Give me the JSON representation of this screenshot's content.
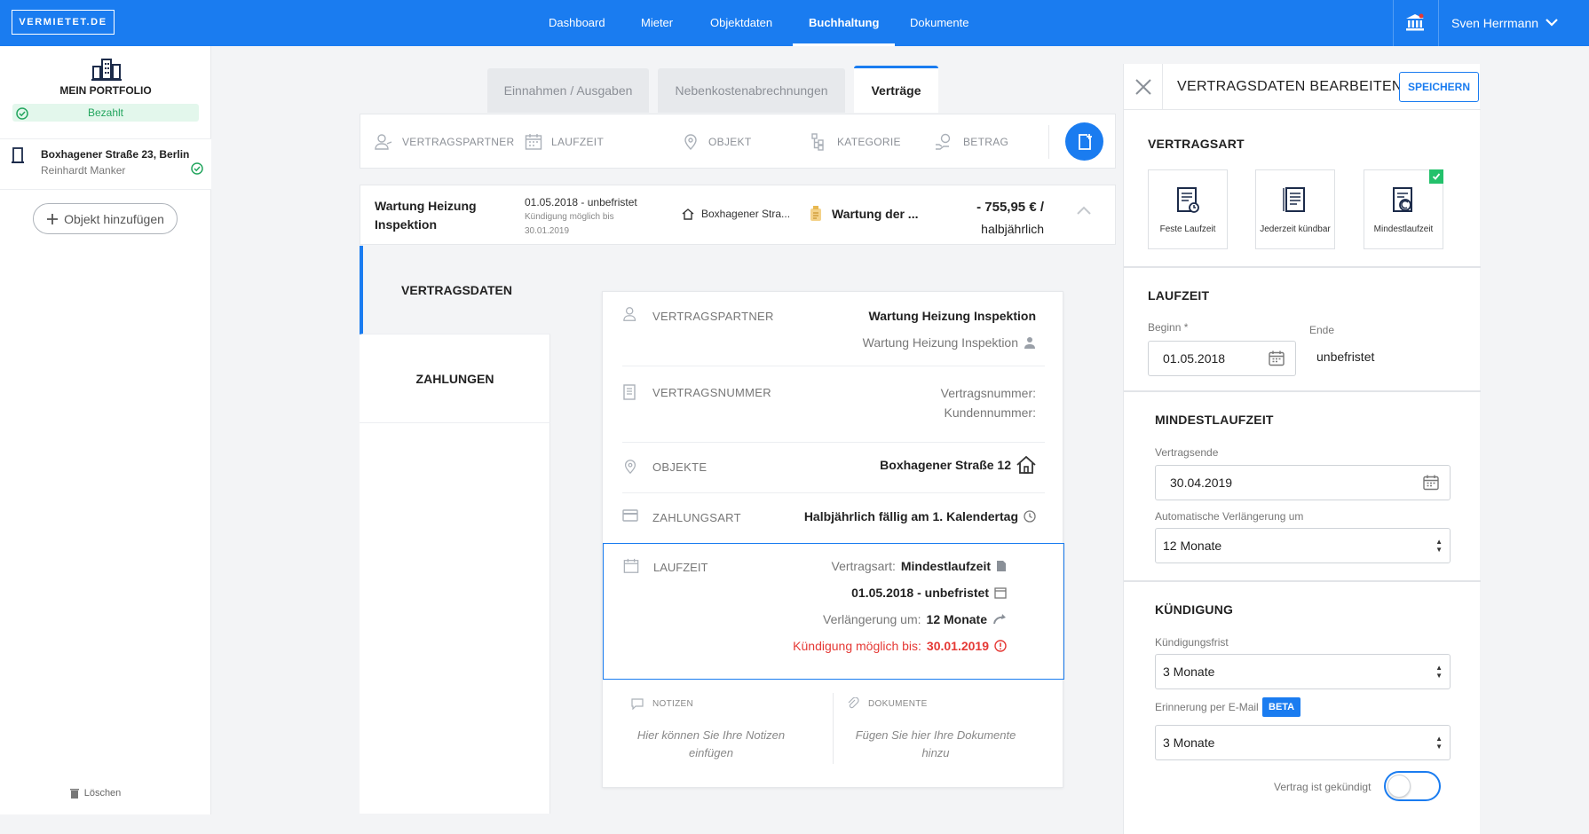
{
  "app": {
    "logo": "VERMIETET.DE",
    "brand_color": "#1a7cf0"
  },
  "nav": {
    "items": [
      "Dashboard",
      "Mieter",
      "Objektdaten",
      "Buchhaltung",
      "Dokumente"
    ],
    "active": "Buchhaltung",
    "user": "Sven Herrmann"
  },
  "sidebar": {
    "title": "MEIN PORTFOLIO",
    "status": "Bezahlt",
    "object": {
      "name": "Boxhagener Straße 23, Berlin",
      "tenant": "Reinhardt Manker"
    },
    "add_label": "Objekt hinzufügen"
  },
  "tabs": [
    "Einnahmen / Ausgaben",
    "Nebenkostenabrechnungen",
    "Verträge"
  ],
  "filters": [
    "VERTRAGSPARTNER",
    "LAUFZEIT",
    "OBJEKT",
    "KATEGORIE",
    "BETRAG"
  ],
  "contract": {
    "title": "Wartung Heizung Inspektion",
    "period": "01.05.2018 - unbefristet",
    "cancel_note": "Kündigung möglich bis 30.01.2019",
    "object": "Boxhagener Stra...",
    "category": "Wartung der ...",
    "amount": "- 755,95 € /",
    "interval": "halbjährlich"
  },
  "detail_nav": {
    "vertragsdaten": "VERTRAGSDATEN",
    "zahlungen": "ZAHLUNGEN",
    "delete": "Löschen"
  },
  "details": {
    "vertragspartner": {
      "label": "VERTRAGSPARTNER",
      "value": "Wartung Heizung Inspektion",
      "sub": "Wartung Heizung Inspektion"
    },
    "vertragsnummer": {
      "label": "VERTRAGSNUMMER",
      "line1": "Vertragsnummer:",
      "line2": "Kundennummer:"
    },
    "objekte": {
      "label": "OBJEKTE",
      "value": "Boxhagener Straße 12"
    },
    "zahlungsart": {
      "label": "ZAHLUNGSART",
      "value": "Halbjährlich fällig am 1. Kalendertag"
    },
    "laufzeit": {
      "label": "LAUFZEIT",
      "type_label": "Vertragsart:",
      "type_value": "Mindestlaufzeit",
      "period": "01.05.2018 - unbefristet",
      "ext_label": "Verlängerung um:",
      "ext_value": "12 Monate",
      "cancel_label": "Kündigung möglich bis:",
      "cancel_value": "30.01.2019"
    },
    "notizen": {
      "label": "NOTIZEN",
      "placeholder": "Hier können Sie Ihre Notizen einfügen"
    },
    "dokumente": {
      "label": "DOKUMENTE",
      "placeholder": "Fügen Sie hier Ihre Dokumente hinzu"
    }
  },
  "panel": {
    "title": "VERTRAGSDATEN BEARBEITEN",
    "save": "SPEICHERN",
    "vertragsart": {
      "title": "VERTRAGSART",
      "options": [
        "Feste Laufzeit",
        "Jederzeit kündbar",
        "Mindestlaufzeit"
      ],
      "selected": "Mindestlaufzeit"
    },
    "laufzeit": {
      "title": "LAUFZEIT",
      "begin_label": "Beginn *",
      "begin_value": "01.05.2018",
      "end_label": "Ende",
      "end_value": "unbefristet"
    },
    "mindestlaufzeit": {
      "title": "MINDESTLAUFZEIT",
      "end_label": "Vertragsende",
      "end_value": "30.04.2019",
      "ext_label": "Automatische Verlängerung um",
      "ext_value": "12 Monate"
    },
    "kuendigung": {
      "title": "KÜNDIGUNG",
      "frist_label": "Kündigungsfrist",
      "frist_value": "3 Monate",
      "reminder_label": "Erinnerung per E-Mail",
      "beta": "BETA",
      "reminder_value": "3 Monate",
      "cancelled_label": "Vertrag ist gekündigt",
      "cancelled": false
    }
  }
}
